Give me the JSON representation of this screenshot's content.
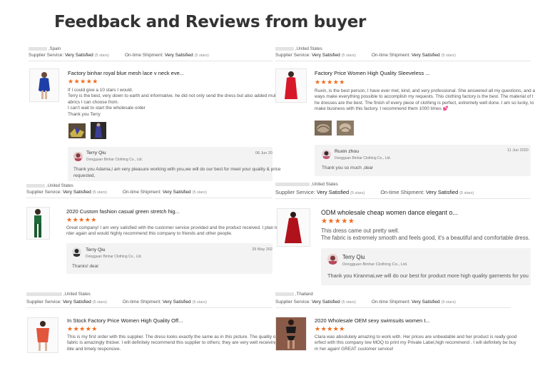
{
  "heading": "Feedback and Reviews from buyer",
  "labels": {
    "supplier_service": "Supplier Service:",
    "on_time_shipment": "On-time Shipment:",
    "stars": "(5 stars)"
  },
  "colors": {
    "star": "#f26b1d",
    "reply_bg": "#f3f3f3"
  },
  "reviews": [
    {
      "country": ",Spain",
      "supplier_rating": "Very Satisfied",
      "shipment_rating": "Very Satisfied",
      "product_title": "Factory binhar royal blue mesh lace v neck eve...",
      "stars": "★★★★★",
      "text": [
        "If I could give a 10 stars I would.",
        "Terry is the best, very down to earth and informative. he did not only send the dress but also added multiple f",
        "abrics I can choose from.",
        "I can't wait to start the wholesale order",
        "Thank you Terry"
      ],
      "reply": {
        "name": "Terry Qiu",
        "company": "Dongguan Binhar Clothing Co., Ltd.",
        "date": "08 Jun 20",
        "text": [
          "Thank you Adama,I am very pleasure working with you,we will do our best for meet your quality & price",
          "requested,"
        ]
      }
    },
    {
      "country": ",United States",
      "supplier_rating": "Very Satisfied",
      "shipment_rating": "Very Satisfied",
      "product_title": "Factory Price Women High Quality Sleeveless ...",
      "stars": "★★★★★",
      "text": [
        "Ruxin, is the best person, I have ever met, kind, and very professional. She answered all my questions, and al",
        "ways make everything possible to accomplish my requests. This clothing factory is the best. The material of t",
        "he dresses are the best. The finish of every piece of clothing is perfect, extremely well done. I am so lucky, to",
        "make business with this factory. I recommend them 1000 times 💕"
      ],
      "reply": {
        "name": "Ruxin zhou",
        "company": "Dongguan Binhar Clothing Co., Ltd.",
        "date": "11 Jun 2020",
        "text": [
          "Thank you so much ,dear"
        ]
      }
    },
    {
      "country": ",United States",
      "supplier_rating": "Very Satisfied",
      "shipment_rating": "Very Satisfied",
      "product_title": "2020 Custom fashion casual green stretch hig...",
      "stars": "★★★★★",
      "text": [
        "Great company! I am very satisfied with the customer service provided and the product received. I plan to o",
        "rder again and would highly recommend this company to friends and other people."
      ],
      "reply": {
        "name": "Terry Qiu",
        "company": "Dongguan Binhar Clothing Co., Ltd.",
        "date": "29 May 202",
        "text": [
          "Thanks! dear"
        ]
      }
    },
    {
      "country": ",United States",
      "supplier_rating": "Very Satisfied",
      "shipment_rating": "Very Satisfied",
      "product_title": "ODM wholesale cheap women dance elegant o...",
      "stars": "★★★★★",
      "text": [
        "This dress came out pretty well.",
        "The fabric is extremely smooth and feels good, it's a beautiful and comfortable dress."
      ],
      "reply": {
        "name": "Terry Qiu",
        "company": "Dongguan Binhar Clothing Co., Ltd.",
        "date": "",
        "text": [
          "Thank you Kiranmai,we will do our best for product more high quality garments for you"
        ]
      }
    },
    {
      "country": ",United States",
      "supplier_rating": "Very Satisfied",
      "shipment_rating": "Very Satisfied",
      "product_title": "In Stock Factory Price Women High Quality Off...",
      "stars": "★★★★★",
      "text": [
        "This is my first order with this supplier. The dress looks exactly the same as in this picture. The quality of the",
        "fabric is amazingly thicker. I will definitely recommend this supplier to others; they are very well receiving, flex",
        "ible and timely responsive."
      ]
    },
    {
      "country": ",Thailand",
      "supplier_rating": "Very Satisfied",
      "shipment_rating": "Very Satisfied",
      "product_title": "2020 Wholesale OEM sexy swimsuits women t...",
      "stars": "★★★★★",
      "text": [
        "Clara was absolutely amazing to work with. Her prices are unbeatable and her product is really good",
        "erfect with this company low MOQ to print my Private Label,high recommend . I will definitely be buy",
        "m her again! GREAT customer service!"
      ]
    }
  ]
}
